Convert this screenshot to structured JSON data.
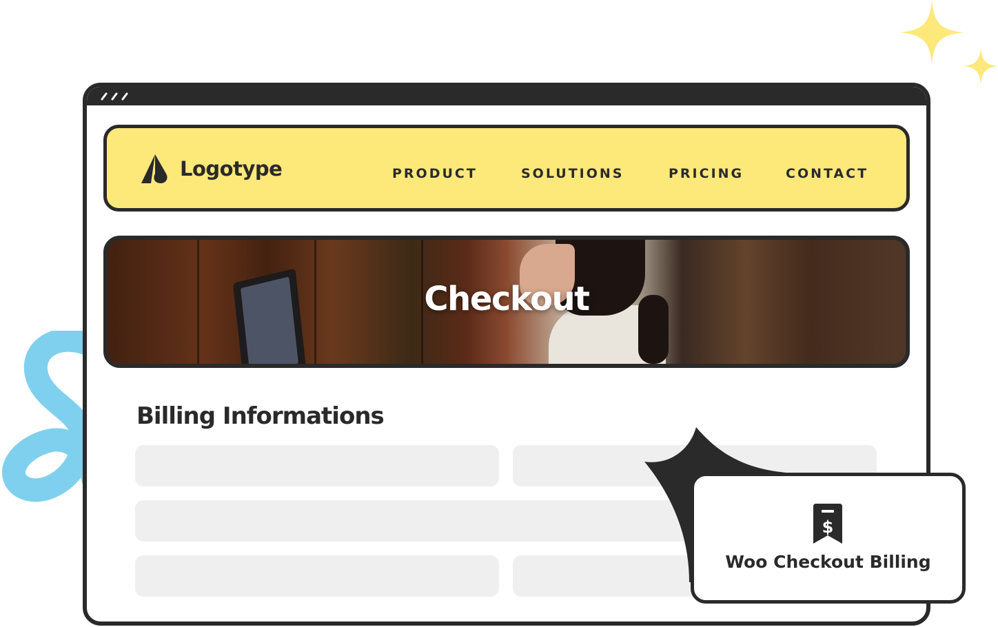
{
  "logo": {
    "text": "Logotype",
    "icon": "logo-mark-icon"
  },
  "nav": {
    "items": [
      {
        "label": "PRODUCT"
      },
      {
        "label": "SOLUTIONS"
      },
      {
        "label": "PRICING"
      },
      {
        "label": "CONTACT"
      }
    ]
  },
  "hero": {
    "title": "Checkout"
  },
  "billing": {
    "heading": "Billing Informations",
    "fields": [
      {
        "placeholder": ""
      },
      {
        "placeholder": ""
      },
      {
        "placeholder": ""
      },
      {
        "placeholder": ""
      },
      {
        "placeholder": ""
      }
    ]
  },
  "card": {
    "label": "Woo Checkout Billing",
    "icon": "receipt-dollar-icon"
  },
  "colors": {
    "nav_bg": "#fde87a",
    "frame": "#2a2a2a",
    "field_bg": "#efefef",
    "sparkle": "#fde87a",
    "squiggle": "#7fd0ee"
  }
}
